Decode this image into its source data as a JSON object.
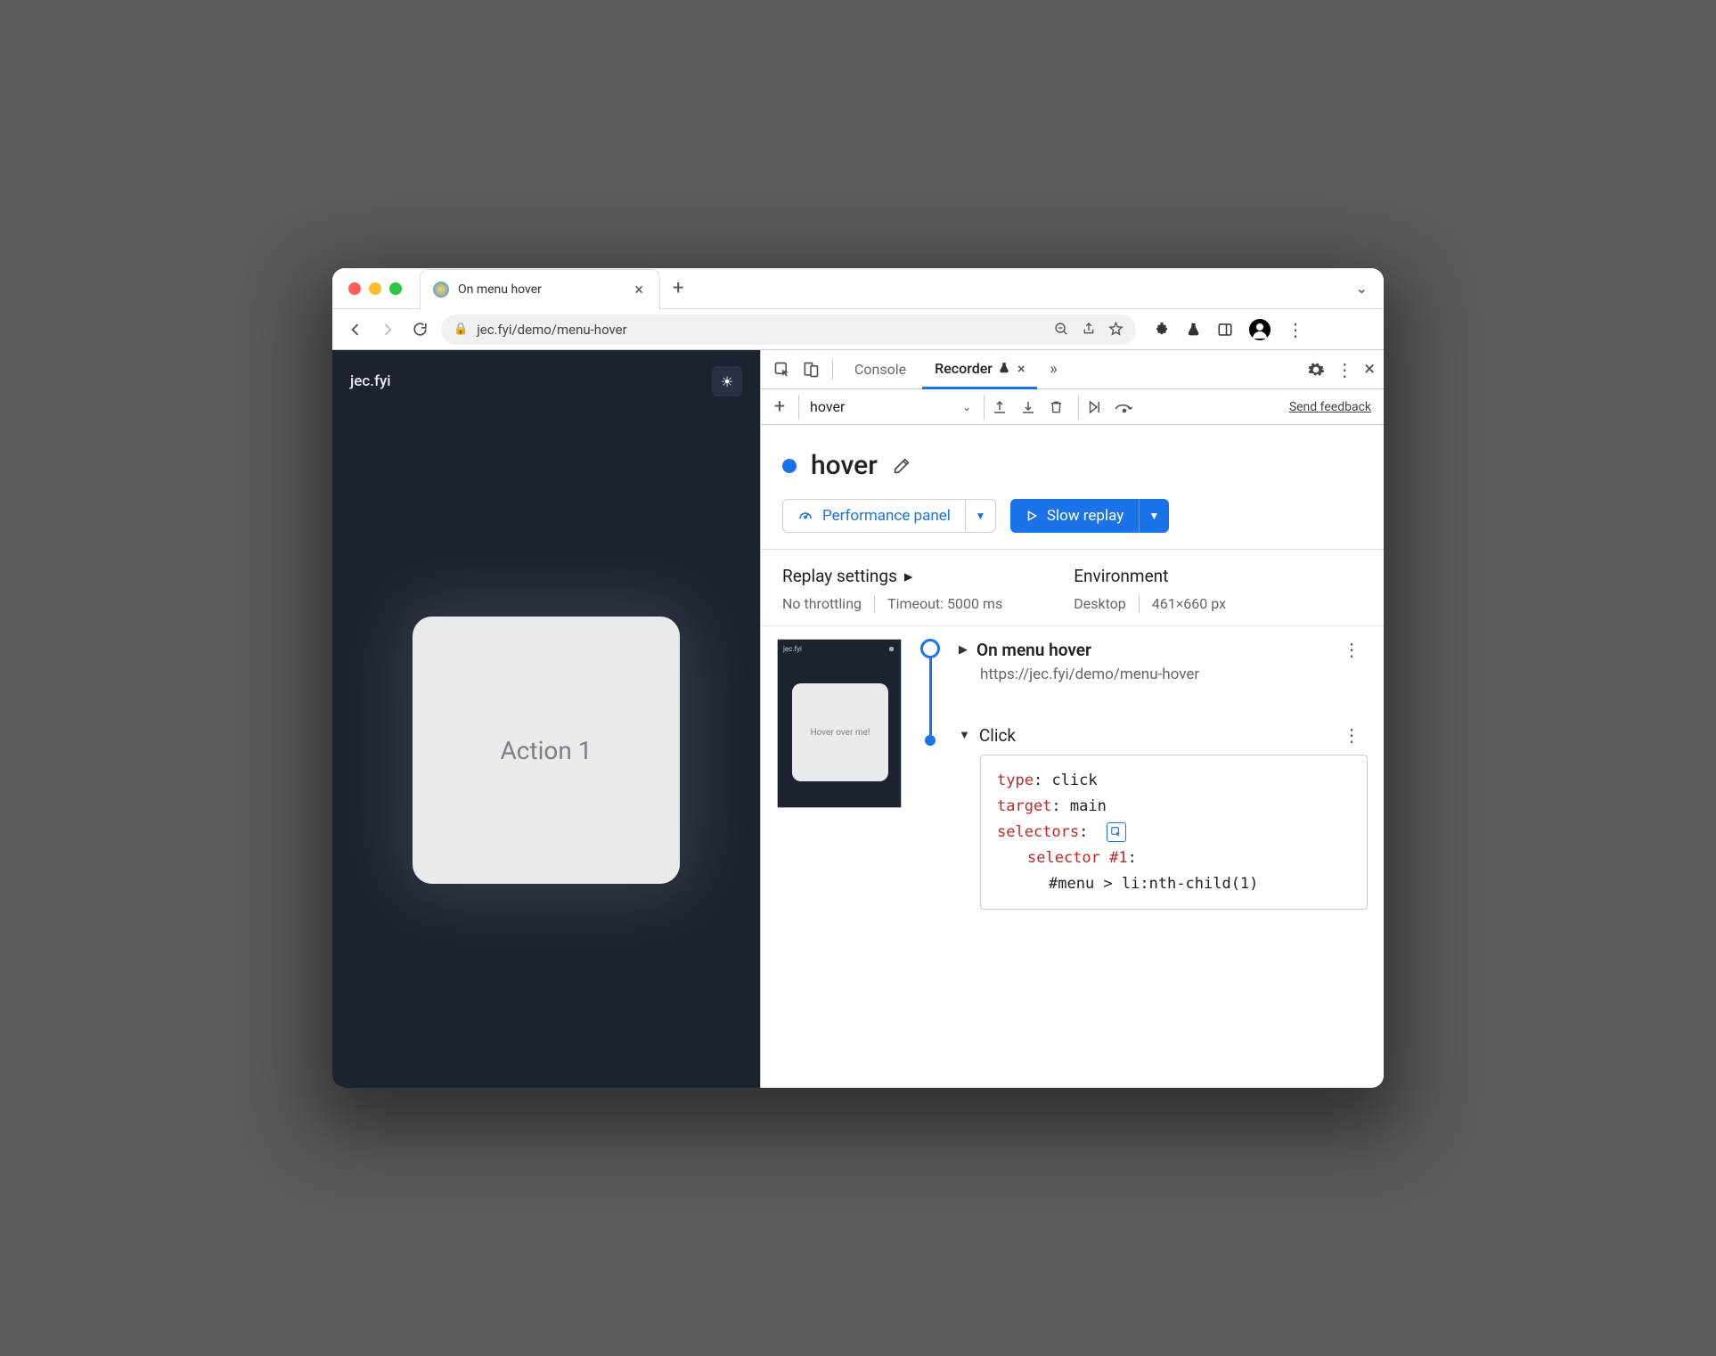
{
  "browser": {
    "tab_title": "On menu hover",
    "url": "jec.fyi/demo/menu-hover"
  },
  "page": {
    "brand": "jec.fyi",
    "card_text": "Action 1"
  },
  "devtools": {
    "tabs": {
      "console": "Console",
      "recorder": "Recorder"
    },
    "feedback": "Send feedback",
    "recording_selector": "hover"
  },
  "recording": {
    "title": "hover",
    "perf_button": "Performance panel",
    "replay_button": "Slow replay",
    "replay_settings_title": "Replay settings",
    "environment_title": "Environment",
    "throttling": "No throttling",
    "timeout": "Timeout: 5000 ms",
    "env_device": "Desktop",
    "env_size": "461×660 px"
  },
  "thumb": {
    "brand": "jec.fyi",
    "card": "Hover over me!"
  },
  "steps": {
    "nav_title": "On menu hover",
    "nav_url": "https://jec.fyi/demo/menu-hover",
    "click_title": "Click",
    "details": {
      "type_key": "type",
      "type_val": "click",
      "target_key": "target",
      "target_val": "main",
      "selectors_key": "selectors",
      "selector_label": "selector #1",
      "selector_val": "#menu > li:nth-child(1)"
    }
  }
}
